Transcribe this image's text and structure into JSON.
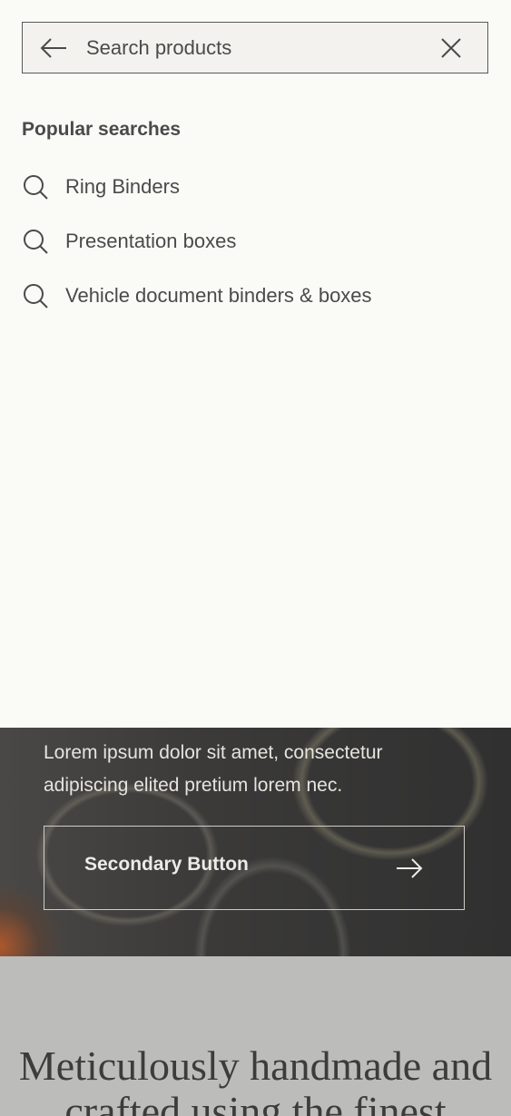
{
  "search": {
    "placeholder": "Search products",
    "value": ""
  },
  "icons": {
    "back": "arrow-left-icon",
    "clear": "close-icon",
    "suggestion": "search-icon",
    "button": "arrow-right-icon"
  },
  "popular": {
    "heading": "Popular searches",
    "items": [
      {
        "label": "Ring Binders"
      },
      {
        "label": "Presentation boxes"
      },
      {
        "label": "Vehicle document binders & boxes"
      }
    ]
  },
  "hero": {
    "description": "Lorem ipsum dolor sit amet, consectetur adipiscing elited pretium lorem nec.",
    "secondary_button_label": "Secondary Button"
  },
  "tagline": {
    "text": "Meticulously handmade and crafted using the finest"
  },
  "colors": {
    "background": "#fafaf6",
    "search_field": "#f4f2ee",
    "text": "#4a4a4a",
    "tagline_band": "#bcbcba"
  }
}
